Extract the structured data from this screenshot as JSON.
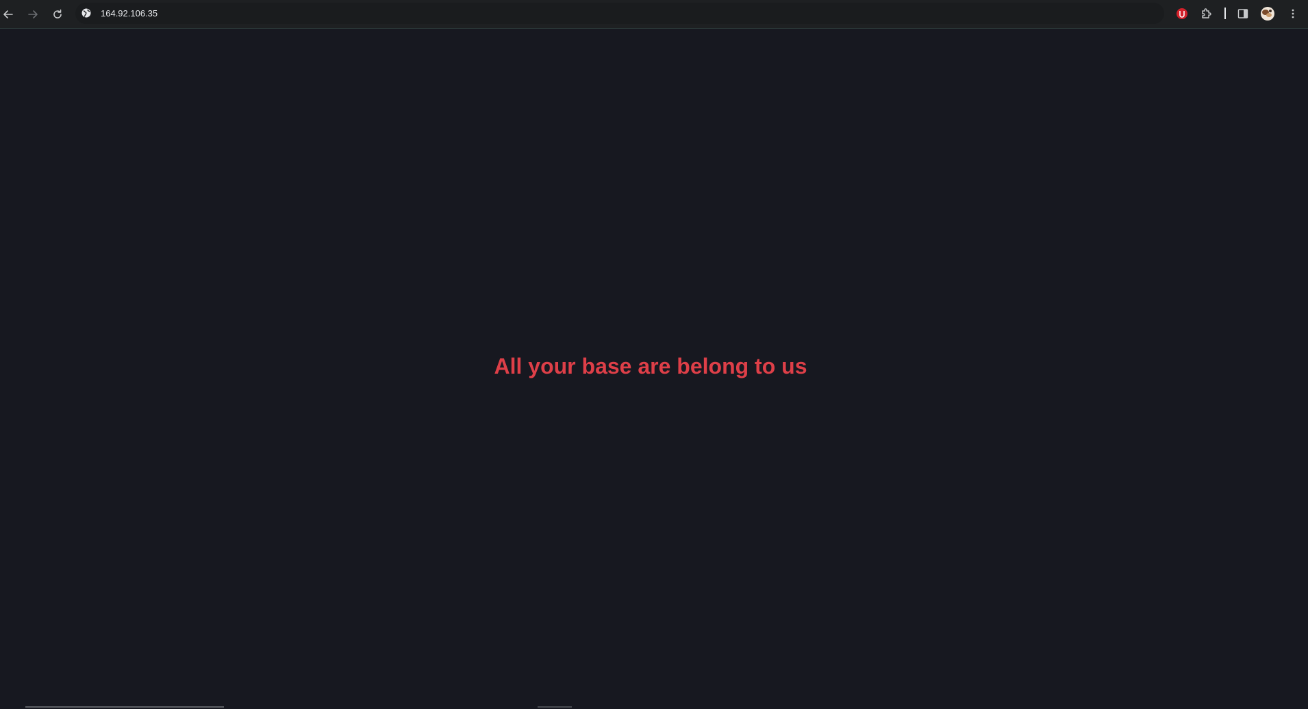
{
  "browser": {
    "url": "164.92.106.35",
    "icons": {
      "back": "arrow-left-icon",
      "forward": "arrow-right-icon",
      "reload": "reload-icon",
      "site_info": "globe-icon",
      "extension_red": "red-shield-extension-icon",
      "extensions": "puzzle-piece-icon",
      "side_panel": "side-panel-icon",
      "profile": "avatar",
      "menu": "kebab-menu-icon"
    }
  },
  "page": {
    "headline": "All your base are belong to us"
  },
  "colors": {
    "page_background": "#171820",
    "headline": "#de3f48",
    "toolbar": "#1e2022"
  }
}
